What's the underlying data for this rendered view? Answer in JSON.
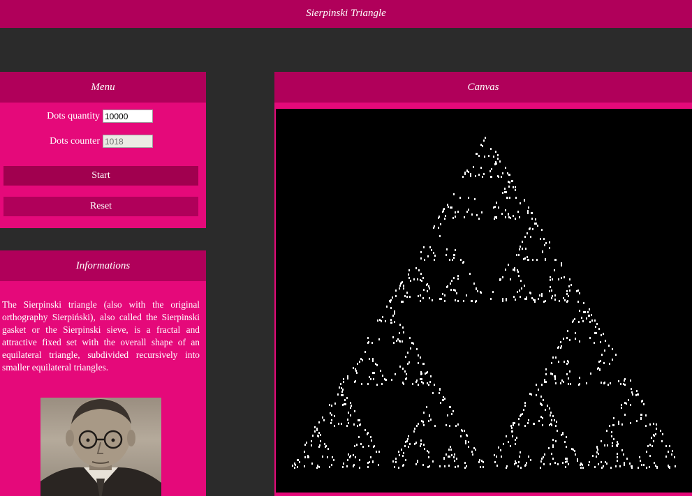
{
  "header": {
    "title": "Sierpinski Triangle"
  },
  "menu": {
    "title": "Menu",
    "dots_quantity_label": "Dots quantity",
    "dots_quantity_value": "10000",
    "dots_counter_label": "Dots counter",
    "dots_counter_value": "1018",
    "start_label": "Start",
    "reset_label": "Reset"
  },
  "info": {
    "title": "Informations",
    "text": "The Sierpinski triangle (also with the original orthography Sierpiński), also called the Sierpinski gasket or the Sierpinski sieve, is a fractal and attractive fixed set with the overall shape of an equilateral triangle, subdivided recursively into smaller equilateral triangles."
  },
  "canvas": {
    "title": "Canvas",
    "dot_color": "#ffffff",
    "background_color": "#000000",
    "dots_drawn": 1018
  },
  "colors": {
    "accent_dark": "#b0005a",
    "accent": "#e5097a",
    "page_bg": "#2b2b2b"
  }
}
